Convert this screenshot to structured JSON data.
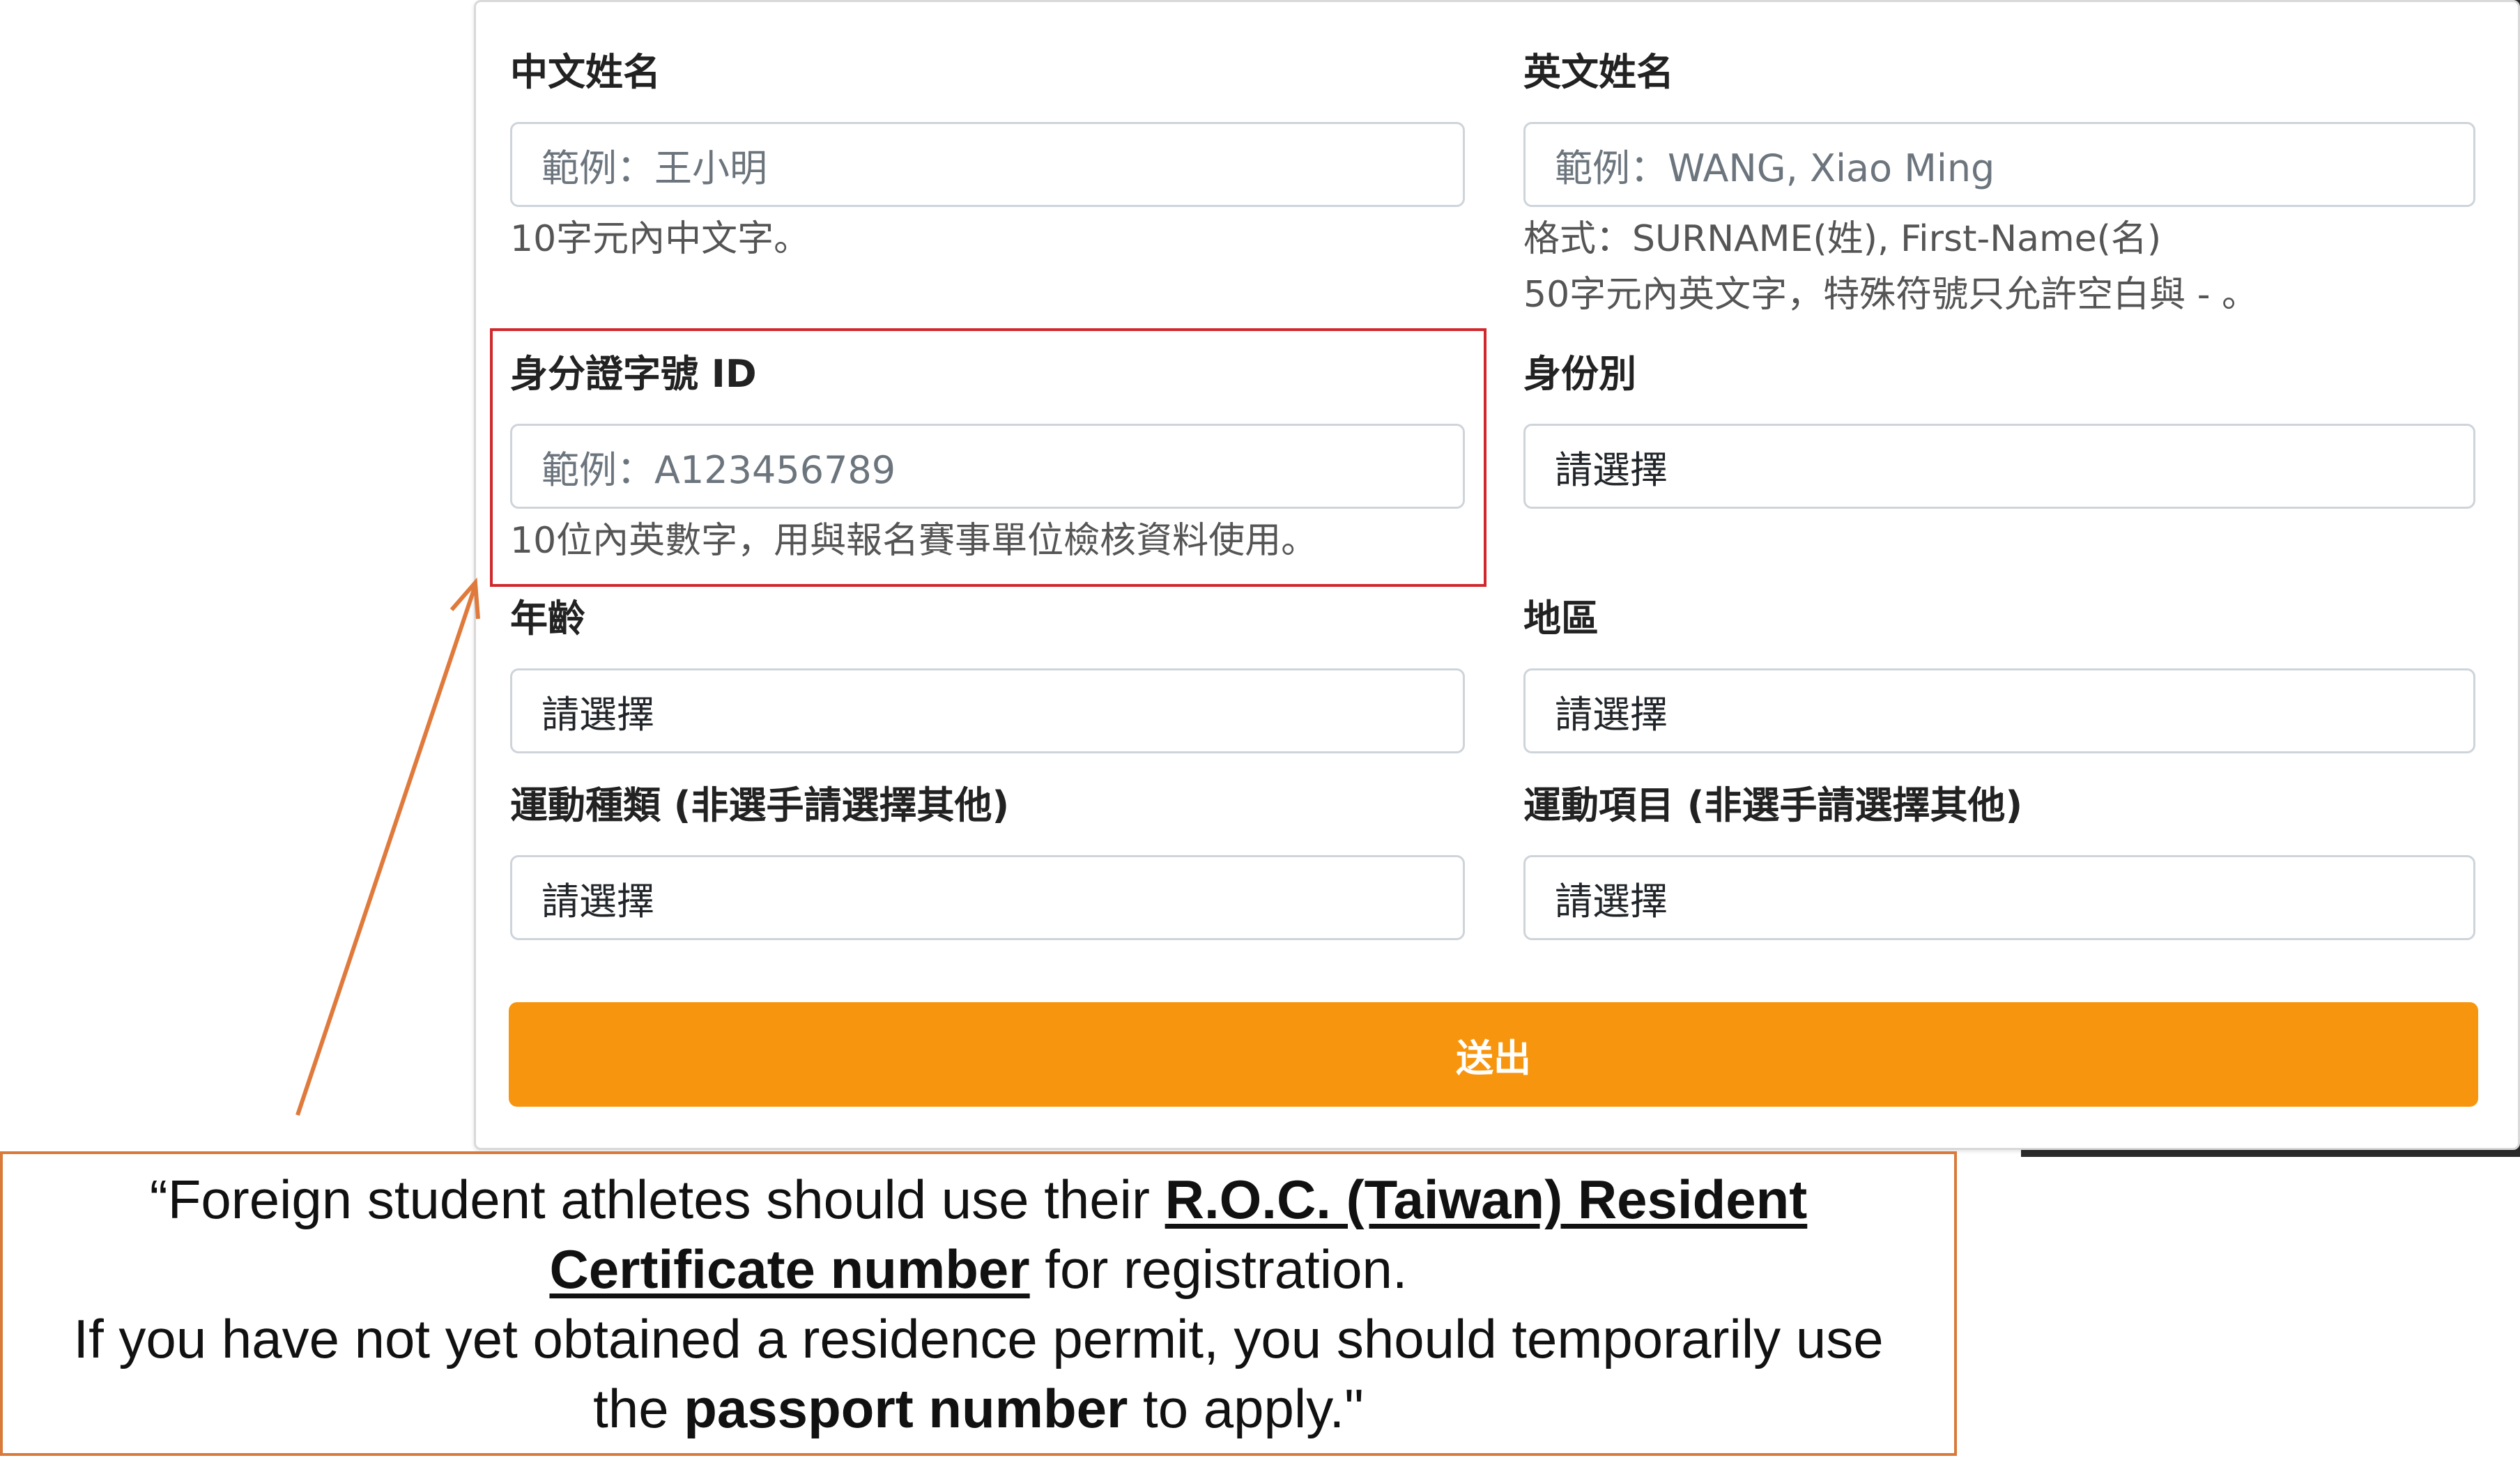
{
  "form": {
    "chinese_name": {
      "label": "中文姓名",
      "placeholder": "範例：王小明",
      "help": "10字元內中文字。"
    },
    "english_name": {
      "label": "英文姓名",
      "placeholder": "範例：WANG, Xiao Ming",
      "help_1": "格式：SURNAME(姓), First-Name(名)",
      "help_2": "50字元內英文字，特殊符號只允許空白與 - 。"
    },
    "id_number": {
      "label": "身分證字號 ID",
      "placeholder": "範例：A123456789",
      "help": "10位內英數字，用與報名賽事單位檢核資料使用。"
    },
    "identity": {
      "label": "身份別",
      "selected": "請選擇"
    },
    "age": {
      "label": "年齡",
      "selected": "請選擇"
    },
    "region": {
      "label": "地區",
      "selected": "請選擇"
    },
    "sport_type": {
      "label": "運動種類 (非選手請選擇其他)",
      "selected": "請選擇"
    },
    "sport_event": {
      "label": "運動項目 (非選手請選擇其他)",
      "selected": "請選擇"
    },
    "submit_label": "送出"
  },
  "annotation": {
    "line1_prefix": "“Foreign student athletes should use their ",
    "line1_bold": "R.O.C. (Taiwan) Resident",
    "line2_bold": "Certificate number",
    "line2_suffix": " for registration.",
    "line3": "If you have not yet obtained a residence permit, you should temporarily use",
    "line4_prefix": "the ",
    "line4_bold": "passport number",
    "line4_suffix": " to apply.\""
  },
  "colors": {
    "highlight_border": "#d0282c",
    "arrow": "#e07a3c",
    "submit_button": "#f7960e",
    "note_border": "#d97a3a"
  }
}
